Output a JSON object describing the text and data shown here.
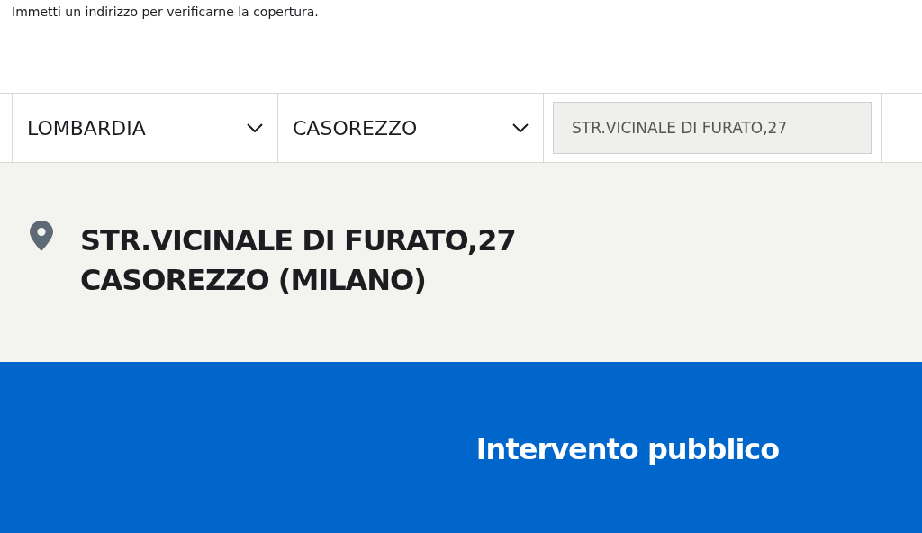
{
  "intro": "Immetti un indirizzo per verificarne la copertura.",
  "filters": [
    {
      "kind": "select",
      "value": "LOMBARDIA"
    },
    {
      "kind": "select",
      "value": "CASOREZZO"
    },
    {
      "kind": "input",
      "value": "STR.VICINALE DI FURATO,27"
    }
  ],
  "address": {
    "lines": [
      "STR.VICINALE DI FURATO,27",
      "CASOREZZO (MILANO)"
    ]
  },
  "result": {
    "title": "Intervento pubblico"
  }
}
